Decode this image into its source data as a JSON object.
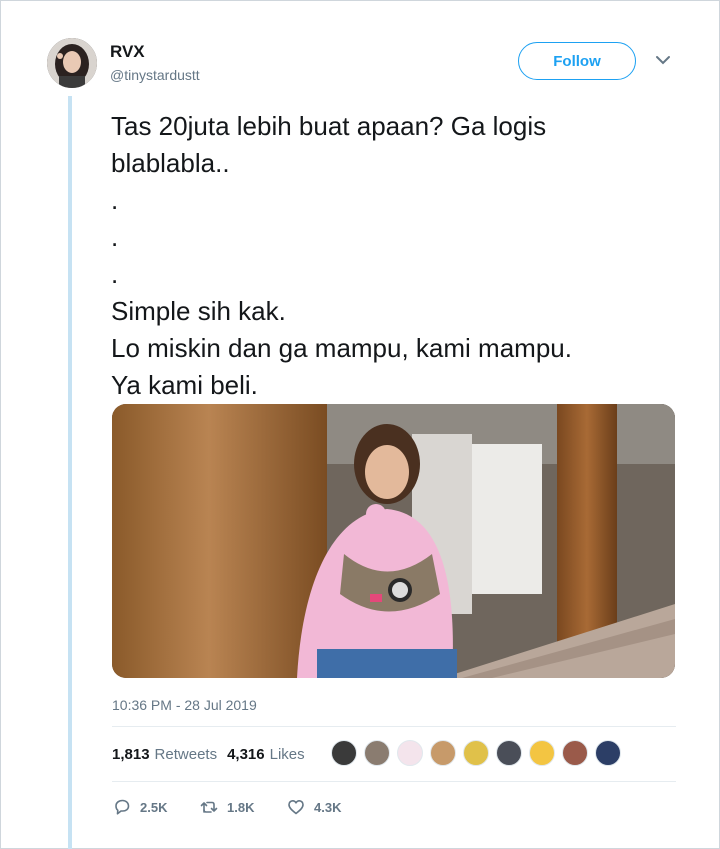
{
  "user": {
    "name": "RVX",
    "handle": "@tinystardustt"
  },
  "follow_label": "Follow",
  "tweet": {
    "lines": [
      "Tas 20juta lebih buat apaan? Ga logis",
      "blablabla..",
      ".",
      ".",
      ".",
      "Simple sih kak.",
      "Lo miskin dan ga mampu, kami mampu.",
      "Ya kami beli."
    ],
    "timestamp": "10:36 PM - 28 Jul 2019"
  },
  "stats": {
    "retweets_count": "1,813",
    "retweets_label": "Retweets",
    "likes_count": "4,316",
    "likes_label": "Likes"
  },
  "actions": {
    "reply_count": "2.5K",
    "retweet_count": "1.8K",
    "like_count": "4.3K"
  },
  "colors": {
    "accent": "#1da1f2",
    "thread_line": "#c6e2f3",
    "secondary_text": "#657786"
  },
  "icons": [
    "chevron-down-icon",
    "reply-icon",
    "retweet-icon",
    "heart-icon"
  ]
}
